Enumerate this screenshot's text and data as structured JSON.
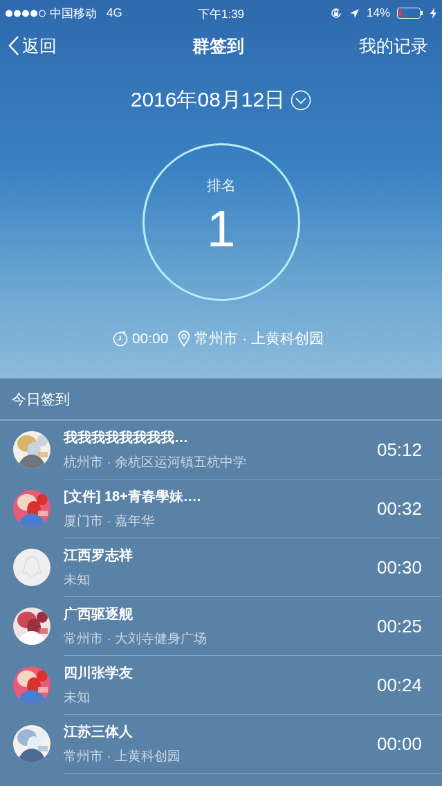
{
  "status_bar": {
    "carrier": "中国移动",
    "network": "4G",
    "time": "下午1:39",
    "battery": "14%"
  },
  "nav": {
    "back": "返回",
    "title": "群签到",
    "action": "我的记录"
  },
  "header": {
    "date": "2016年08月12日",
    "rank_label": "排名",
    "rank": "1",
    "time": "00:00",
    "location": "常州市 · 上黄科创园"
  },
  "section_title": "今日签到",
  "checkins": [
    {
      "name": "我我我我我我我我…",
      "location": "杭州市 · 余杭区运河镇五杭中学",
      "time": "05:12",
      "kind": "picture"
    },
    {
      "name": "[文件] 18+青春學妹….",
      "location": "厦门市 · 嘉年华",
      "time": "00:32",
      "kind": "picture"
    },
    {
      "name": "江西罗志祥",
      "location": "未知",
      "time": "00:30",
      "kind": "default"
    },
    {
      "name": "广西驱逐舰",
      "location": "常州市 · 大刘寺健身广场",
      "time": "00:25",
      "kind": "picture"
    },
    {
      "name": "四川张学友",
      "location": "未知",
      "time": "00:24",
      "kind": "picture"
    },
    {
      "name": "江苏三体人",
      "location": "常州市 · 上黄科创园",
      "time": "00:00",
      "kind": "picture"
    }
  ]
}
